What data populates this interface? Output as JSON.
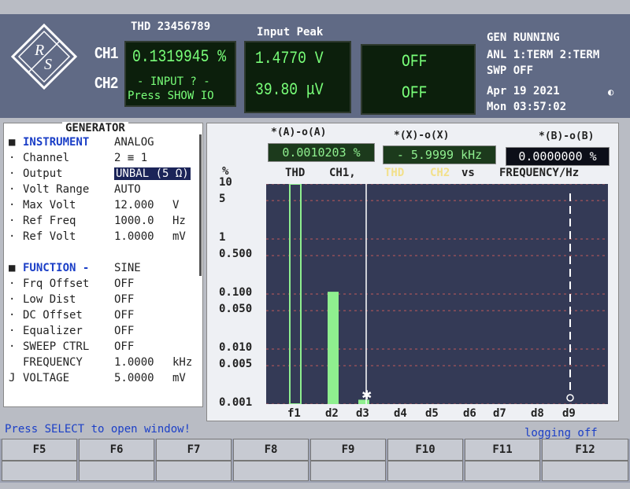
{
  "top": {
    "thd_title": "THD 23456789",
    "input_peak_title": "Input Peak",
    "ch1_label": "CH1",
    "ch2_label": "CH2",
    "thd_value": "0.1319945 %",
    "ch2_msg_line1": "- INPUT ? -",
    "ch2_msg_line2": "Press SHOW IO",
    "peak_ch1": "1.4770  V",
    "peak_ch2": "39.80 μV",
    "third_ch1": "OFF",
    "third_ch2": "OFF",
    "status_line1": "GEN RUNNING",
    "status_line2": "ANL 1:TERM 2:TERM",
    "status_line3": "SWP OFF",
    "date": "Apr 19 2021",
    "time": "Mon 03:57:02",
    "indicator": "◐"
  },
  "generator": {
    "title": "GENERATOR",
    "instrument_label": "INSTRUMENT",
    "instrument_value": "ANALOG",
    "channel_label": "Channel",
    "channel_value": "2 ≡ 1",
    "output_label": "Output",
    "output_value": "UNBAL (5 Ω)",
    "volt_range_label": "Volt Range",
    "volt_range_value": "AUTO",
    "max_volt_label": "Max Volt",
    "max_volt_value": "12.000",
    "max_volt_unit": "V",
    "ref_freq_label": "Ref Freq",
    "ref_freq_value": "1000.0",
    "ref_freq_unit": "Hz",
    "ref_volt_label": "Ref Volt",
    "ref_volt_value": "1.0000",
    "ref_volt_unit": "mV",
    "function_label": "FUNCTION -",
    "function_value": "SINE",
    "frq_offset_label": "Frq Offset",
    "frq_offset_value": "OFF",
    "low_dist_label": "Low Dist",
    "low_dist_value": "OFF",
    "dc_offset_label": "DC Offset",
    "dc_offset_value": "OFF",
    "equalizer_label": "Equalizer",
    "equalizer_value": "OFF",
    "sweep_ctrl_label": "SWEEP CTRL",
    "sweep_ctrl_value": "OFF",
    "frequency_label": "FREQUENCY",
    "frequency_value": "1.0000",
    "frequency_unit": "kHz",
    "voltage_label": "VOLTAGE",
    "voltage_value": "5.0000",
    "voltage_unit": "mV",
    "voltage_marker": "J"
  },
  "graph": {
    "cursor_a_title": "*(A)-o(A)",
    "cursor_a_value": "0.0010203 %",
    "cursor_x_title": "*(X)-o(X)",
    "cursor_x_value": "- 5.9999 kHz",
    "cursor_b_title": "*(B)-o(B)",
    "cursor_b_value": "0.0000000 %",
    "legend_thd1": "THD",
    "legend_ch1": "CH1,",
    "legend_thd2": "THD",
    "legend_ch2": "CH2",
    "legend_vs": "vs",
    "legend_freq": "FREQUENCY/Hz",
    "yunit": "%",
    "colors": {
      "ch1": "#8fef8f",
      "ch2": "#f2e08a",
      "plot_bg": "#343a56",
      "grid": "#c05a5a"
    }
  },
  "chart_data": {
    "type": "bar",
    "categories": [
      "f1",
      "d2",
      "d3",
      "d4",
      "d5",
      "d6",
      "d7",
      "d8",
      "d9"
    ],
    "values": [
      10,
      0.11,
      0.0012,
      null,
      null,
      null,
      null,
      null,
      null
    ],
    "y_ticks": [
      "10",
      "5",
      "1",
      "0.500",
      "0.100",
      "0.050",
      "0.010",
      "0.005",
      "0.001"
    ],
    "yscale": "log",
    "ylim": [
      0.001,
      10
    ],
    "ylabel": "%",
    "grid": true
  },
  "footer": {
    "hint": "Press SELECT to open window!",
    "logging": "logging off",
    "fkeys": [
      "F5",
      "F6",
      "F7",
      "F8",
      "F9",
      "F10",
      "F11",
      "F12"
    ]
  }
}
